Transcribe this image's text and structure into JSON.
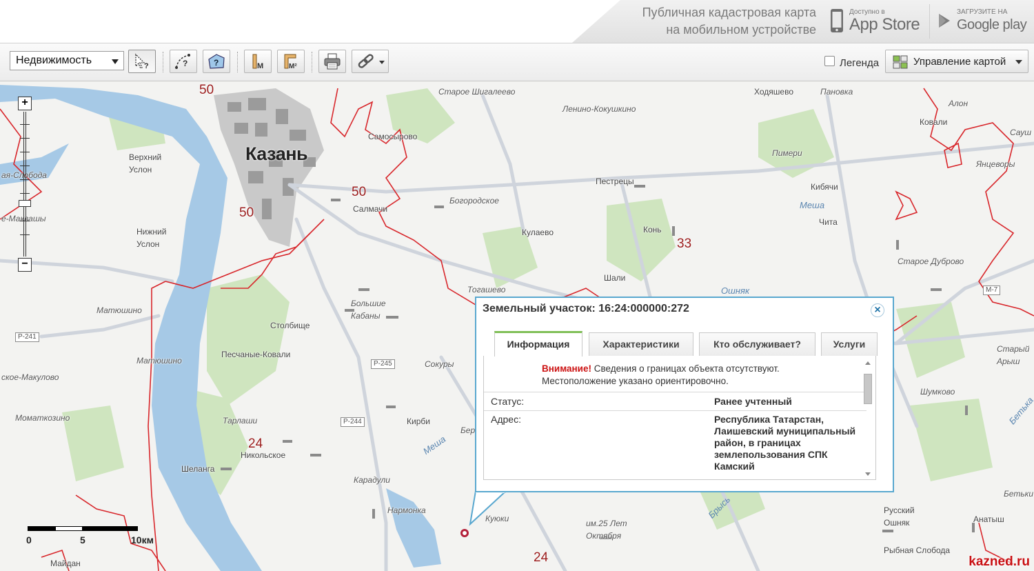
{
  "banner": {
    "promo_line1": "Публичная кадастровая карта",
    "promo_line2": "на мобильном устройстве",
    "appstore_small": "Доступно в",
    "appstore_big": "App Store",
    "gplay_small": "ЗАГРУЗИТЕ НА",
    "gplay_big": "Google play"
  },
  "toolbar": {
    "layer_select": "Недвижимость",
    "buttons": [
      {
        "icon": "identify-cursor-icon"
      },
      {
        "icon": "measure-query-icon"
      },
      {
        "icon": "area-query-icon"
      },
      {
        "icon": "measure-length-icon",
        "label": "М"
      },
      {
        "icon": "measure-area-icon",
        "label": "М²"
      },
      {
        "icon": "print-icon"
      },
      {
        "icon": "link-icon"
      }
    ],
    "legend_label": "Легенда",
    "legend_checked": false,
    "map_manage_label": "Управление картой"
  },
  "map": {
    "city": "Казань",
    "places": [
      "Старое Шигалеево",
      "Ленино-Кокушкино",
      "Ходяшево",
      "Пановка",
      "Алон",
      "Ковали",
      "Сауш",
      "Самосырово",
      "Пимери",
      "Янцеворы",
      "Верхний",
      "Услон",
      "ая-Слобода",
      "Пестрецы",
      "Кибячи",
      "Салмачи",
      "Богородское",
      "Чита",
      "е-Маквашы",
      "Нижний",
      "Услон",
      "Кулаево",
      "Конь",
      "Старое Дуброво",
      "Шали",
      "Тогашево",
      "Матюшино",
      "Большие",
      "Кабаны",
      "Столбище",
      "Песчаные-Ковали",
      "Матюшино",
      "ское-Макулово",
      "Сокуры",
      "Старый",
      "Арыш",
      "Шумково",
      "Моматкозино",
      "Тарлаши",
      "Кирби",
      "Бер",
      "Никольское",
      "Шеланга",
      "Карадули",
      "Нармонка",
      "Куюки",
      "им.25 Лет",
      "Октября",
      "Русский",
      "Ошняк",
      "Анатыш",
      "Рыбная Слобода",
      "Бетьки",
      "Майдан"
    ],
    "region_numbers": [
      "50",
      "50",
      "50",
      "33",
      "24",
      "24",
      "33"
    ],
    "rivers": [
      "Меша",
      "Ошняк",
      "Меша",
      "Брысь",
      "Бетька"
    ],
    "road_shields": [
      "Р-241",
      "Р-245",
      "Р-244",
      "М-7"
    ],
    "scale": {
      "zero": "0",
      "mid": "5",
      "end": "10км"
    },
    "zoom": {
      "plus": "+",
      "minus": "−"
    }
  },
  "popup": {
    "title": "Земельный участок: 16:24:000000:272",
    "close": "×",
    "tabs": [
      "Информация",
      "Характеристики",
      "Кто обслуживает?",
      "Услуги"
    ],
    "active_tab": "Информация",
    "warning_bold": "Внимание!",
    "warning_text": " Сведения о границах объекта отсутствуют.",
    "warning_line2": "Местоположение указано ориентировочно.",
    "status_label": "Статус:",
    "status_value": "Ранее учтенный",
    "address_label": "Адрес:",
    "address_value": "Республика Татарстан, Лаишевский муниципальный район, в границах землепользования СПК Камский"
  },
  "watermark": "kazned.ru",
  "colors": {
    "popup_border": "#58a7cf",
    "active_tab_accent": "#7fbf56",
    "warning": "#cc1212",
    "boundary": "#d8262b",
    "water": "#a6c9e6",
    "forest": "#cfe5bf"
  }
}
